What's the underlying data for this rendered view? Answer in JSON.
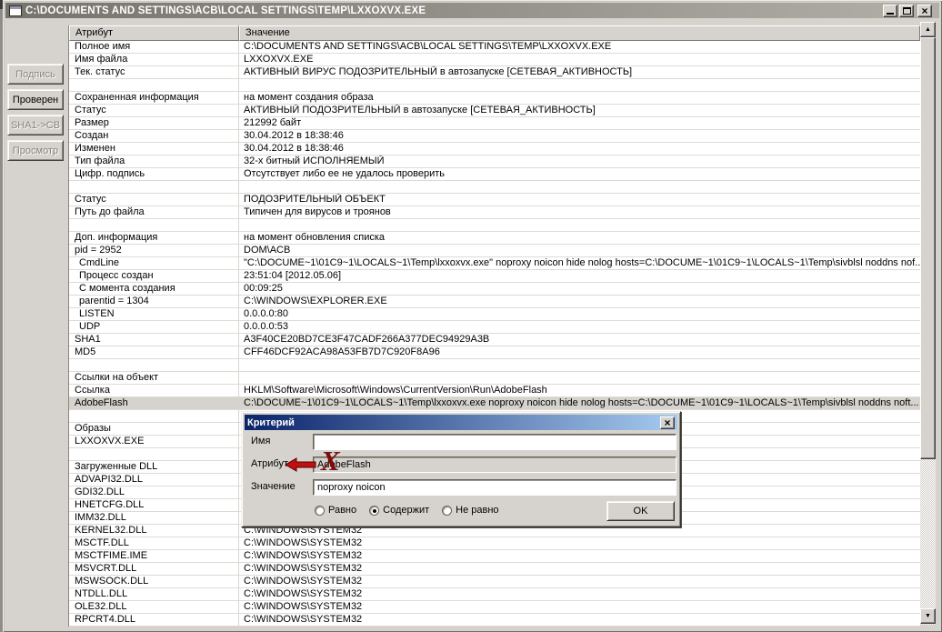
{
  "window": {
    "title": "C:\\DOCUMENTS AND SETTINGS\\ACB\\LOCAL SETTINGS\\TEMP\\LXXOXVX.EXE"
  },
  "sidebar": {
    "buttons": [
      {
        "label": "Подпись",
        "enabled": false
      },
      {
        "label": "Проверен",
        "enabled": true
      },
      {
        "label": "SHA1->CB",
        "enabled": false
      },
      {
        "label": "Просмотр",
        "enabled": false
      }
    ]
  },
  "table": {
    "headers": [
      "Атрибут",
      "Значение"
    ],
    "rows": [
      {
        "attr": "Полное имя",
        "value": "C:\\DOCUMENTS AND SETTINGS\\ACB\\LOCAL SETTINGS\\TEMP\\LXXOXVX.EXE"
      },
      {
        "attr": "Имя файла",
        "value": "LXXOXVX.EXE"
      },
      {
        "attr": "Тек. статус",
        "value": "АКТИВНЫЙ ВИРУС ПОДОЗРИТЕЛЬНЫЙ в автозапуске [СЕТЕВАЯ_АКТИВНОСТЬ]"
      },
      {
        "attr": "",
        "value": ""
      },
      {
        "attr": "Сохраненная информация",
        "value": "на момент создания образа"
      },
      {
        "attr": "Статус",
        "value": "АКТИВНЫЙ ПОДОЗРИТЕЛЬНЫЙ в автозапуске [СЕТЕВАЯ_АКТИВНОСТЬ]"
      },
      {
        "attr": "Размер",
        "value": "212992 байт"
      },
      {
        "attr": "Создан",
        "value": "30.04.2012 в 18:38:46"
      },
      {
        "attr": "Изменен",
        "value": "30.04.2012 в 18:38:46"
      },
      {
        "attr": "Тип файла",
        "value": "32-х битный ИСПОЛНЯЕМЫЙ"
      },
      {
        "attr": "Цифр. подпись",
        "value": "Отсутствует либо ее не удалось проверить"
      },
      {
        "attr": "",
        "value": ""
      },
      {
        "attr": "Статус",
        "value": "ПОДОЗРИТЕЛЬНЫЙ ОБЪЕКТ"
      },
      {
        "attr": "Путь до файла",
        "value": "Типичен для вирусов и троянов"
      },
      {
        "attr": "",
        "value": ""
      },
      {
        "attr": "Доп. информация",
        "value": "на момент обновления списка"
      },
      {
        "attr": "pid = 2952",
        "value": "DOM\\ACB"
      },
      {
        "attr": "CmdLine",
        "value": "\"C:\\DOCUME~1\\01C9~1\\LOCALS~1\\Temp\\lxxoxvx.exe\" noproxy noicon hide nolog hosts=C:\\DOCUME~1\\01C9~1\\LOCALS~1\\Temp\\sivblsl noddns nof...",
        "indent": true
      },
      {
        "attr": "Процесс создан",
        "value": "23:51:04 [2012.05.06]",
        "indent": true
      },
      {
        "attr": "С момента создания",
        "value": "00:09:25",
        "indent": true
      },
      {
        "attr": "parentid = 1304",
        "value": "C:\\WINDOWS\\EXPLORER.EXE",
        "indent": true
      },
      {
        "attr": "LISTEN",
        "value": "0.0.0.0:80",
        "indent": true
      },
      {
        "attr": "UDP",
        "value": "0.0.0.0:53",
        "indent": true
      },
      {
        "attr": "SHA1",
        "value": "A3F40CE20BD7CE3F47CADF266A377DEC94929A3B"
      },
      {
        "attr": "MD5",
        "value": "CFF46DCF92ACA98A53FB7D7C920F8A96"
      },
      {
        "attr": "",
        "value": ""
      },
      {
        "attr": "Ссылки на объект",
        "value": ""
      },
      {
        "attr": "Ссылка",
        "value": "HKLM\\Software\\Microsoft\\Windows\\CurrentVersion\\Run\\AdobeFlash"
      },
      {
        "attr": "AdobeFlash",
        "value": "C:\\DOCUME~1\\01C9~1\\LOCALS~1\\Temp\\lxxoxvx.exe noproxy noicon hide nolog hosts=C:\\DOCUME~1\\01C9~1\\LOCALS~1\\Temp\\sivblsl noddns noft...",
        "highlight": true
      },
      {
        "attr": "",
        "value": ""
      },
      {
        "attr": "Образы",
        "value": ""
      },
      {
        "attr": "LXXOXVX.EXE",
        "value": ""
      },
      {
        "attr": "",
        "value": ""
      },
      {
        "attr": "Загруженные DLL",
        "value": ""
      },
      {
        "attr": "ADVAPI32.DLL",
        "value": ""
      },
      {
        "attr": "GDI32.DLL",
        "value": ""
      },
      {
        "attr": "HNETCFG.DLL",
        "value": ""
      },
      {
        "attr": "IMM32.DLL",
        "value": ""
      },
      {
        "attr": "KERNEL32.DLL",
        "value": "C:\\WINDOWS\\SYSTEM32"
      },
      {
        "attr": "MSCTF.DLL",
        "value": "C:\\WINDOWS\\SYSTEM32"
      },
      {
        "attr": "MSCTFIME.IME",
        "value": "C:\\WINDOWS\\SYSTEM32"
      },
      {
        "attr": "MSVCRT.DLL",
        "value": "C:\\WINDOWS\\SYSTEM32"
      },
      {
        "attr": "MSWSOCK.DLL",
        "value": "C:\\WINDOWS\\SYSTEM32"
      },
      {
        "attr": "NTDLL.DLL",
        "value": "C:\\WINDOWS\\SYSTEM32"
      },
      {
        "attr": "OLE32.DLL",
        "value": "C:\\WINDOWS\\SYSTEM32"
      },
      {
        "attr": "RPCRT4.DLL",
        "value": "C:\\WINDOWS\\SYSTEM32"
      }
    ]
  },
  "dialog": {
    "title": "Критерий",
    "fields": [
      {
        "label": "Имя",
        "value": "",
        "readonly": false
      },
      {
        "label": "Атрибут",
        "value": "AdobeFlash",
        "readonly": true
      },
      {
        "label": "Значение",
        "value": "noproxy noicon",
        "readonly": false
      }
    ],
    "radios": [
      {
        "label": "Равно",
        "checked": false
      },
      {
        "label": "Содержит",
        "checked": true
      },
      {
        "label": "Не равно",
        "checked": false
      }
    ],
    "ok_label": "OK"
  },
  "annotation": {
    "x_mark": "X"
  },
  "colors": {
    "face": "#d6d3ce",
    "active_title_start": "#0a246a",
    "active_title_end": "#a6caf0",
    "inactive_title_start": "#75736c",
    "inactive_title_end": "#b2afa6",
    "highlight_row": "#d6d3ce",
    "annotation_red": "#c01010"
  }
}
